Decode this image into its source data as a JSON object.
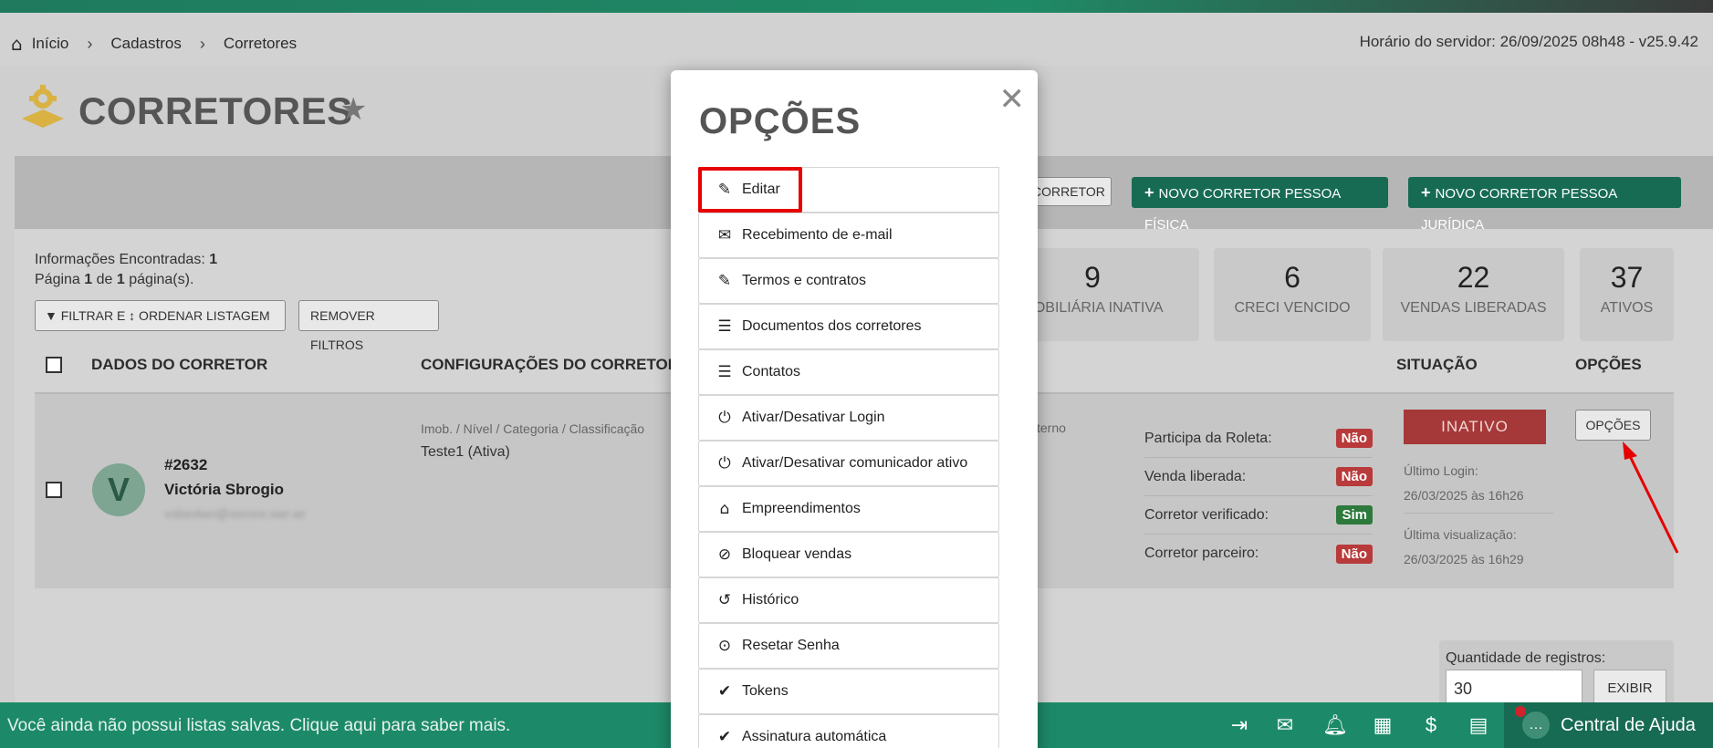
{
  "breadcrumb": {
    "home": "Início",
    "items": [
      "Cadastros",
      "Corretores"
    ]
  },
  "server_time": "Horário do servidor: 26/09/2025 08h48 - v25.9.42",
  "page_title": "CORRETORES",
  "toolbar": {
    "partial_button": "CORRETOR",
    "new_pf": "NOVO CORRETOR PESSOA FÍSICA",
    "new_pj": "NOVO CORRETOR PESSOA JURÍDICA"
  },
  "info": {
    "found_label": "Informações Encontradas:",
    "found_count": "1",
    "page_text_a": "Página",
    "page_num": "1",
    "page_text_b": "de",
    "page_total": "1",
    "page_text_c": "página(s).",
    "filter_button": "FILTRAR E ↕ ORDENAR LISTAGEM",
    "remove_filters": "REMOVER FILTROS"
  },
  "cards": [
    {
      "num": "9",
      "label": "MOBILIÁRIA INATIVA"
    },
    {
      "num": "6",
      "label": "CRECI VENCIDO"
    },
    {
      "num": "22",
      "label": "VENDAS LIBERADAS"
    },
    {
      "num": "37",
      "label": "ATIVOS"
    }
  ],
  "table": {
    "headers": {
      "data": "DADOS DO CORRETOR",
      "config": "CONFIGURAÇÕES DO CORRETOR",
      "status": "SITUAÇÃO",
      "options": "OPÇÕES"
    },
    "row": {
      "avatar_letter": "V",
      "id": "#2632",
      "name": "Victória Sbrogio",
      "email": "vsbsvlwn@osvvnr.vwr.wr",
      "config_caption": "Imob. / Nível / Categoria / Classificação",
      "config_value": "Teste1 (Ativa)",
      "extra_caption": "terno",
      "flags": [
        {
          "label": "Participa da Roleta:",
          "value": "Não",
          "color": "#b83a3a"
        },
        {
          "label": "Venda liberada:",
          "value": "Não",
          "color": "#b83a3a"
        },
        {
          "label": "Corretor verificado:",
          "value": "Sim",
          "color": "#2d7a3c"
        },
        {
          "label": "Corretor parceiro:",
          "value": "Não",
          "color": "#b83a3a"
        }
      ],
      "status": "INATIVO",
      "last_login_label": "Último Login:",
      "last_login_value": "26/03/2025 às 16h26",
      "last_view_label": "Última visualização:",
      "last_view_value": "26/03/2025 às 16h29",
      "options_button": "OPÇÕES"
    }
  },
  "pager": {
    "qty_label": "Quantidade de registros:",
    "qty_value": "30",
    "show_button": "EXIBIR"
  },
  "bottom_bar": {
    "message": "Você ainda não possui listas salvas. Clique aqui para saber mais.",
    "help": "Central de Ajuda"
  },
  "modal": {
    "title": "OPÇÕES",
    "options": [
      {
        "label": "Editar",
        "icon": "edit-icon"
      },
      {
        "label": "Recebimento de e-mail",
        "icon": "envelope-icon"
      },
      {
        "label": "Termos e contratos",
        "icon": "edit-icon"
      },
      {
        "label": "Documentos dos corretores",
        "icon": "list-icon"
      },
      {
        "label": "Contatos",
        "icon": "list-icon"
      },
      {
        "label": "Ativar/Desativar Login",
        "icon": "power-icon"
      },
      {
        "label": "Ativar/Desativar comunicador ativo",
        "icon": "power-icon"
      },
      {
        "label": "Empreendimentos",
        "icon": "home-icon"
      },
      {
        "label": "Bloquear vendas",
        "icon": "ban-icon"
      },
      {
        "label": "Histórico",
        "icon": "history-icon"
      },
      {
        "label": "Resetar Senha",
        "icon": "check-circle-icon"
      },
      {
        "label": "Tokens",
        "icon": "check-icon"
      },
      {
        "label": "Assinatura automática",
        "icon": "check-icon"
      }
    ]
  },
  "colors": {
    "brand_green": "#1c8a68",
    "dark_green": "#176b53",
    "highlight_red": "#e60000",
    "status_red": "#a53838"
  }
}
